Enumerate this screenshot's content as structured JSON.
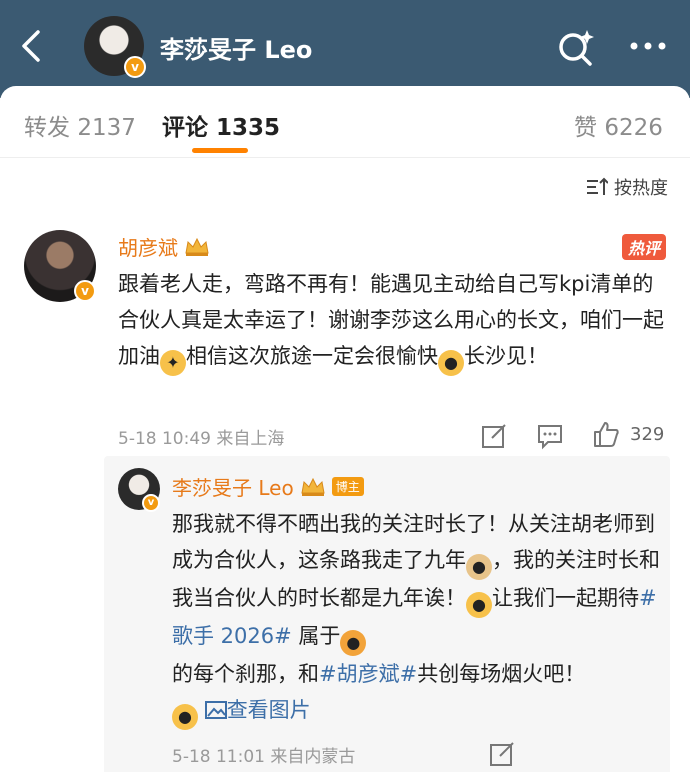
{
  "header": {
    "title": "李莎旻子 Leo",
    "verified_badge": "v",
    "back_icon": "chevron-left-icon",
    "search_icon": "search-sparkle-icon",
    "more_icon": "more-dots-icon"
  },
  "tabs": [
    {
      "label": "转发",
      "count": "2137"
    },
    {
      "label": "评论",
      "count": "1335"
    },
    {
      "label": "赞",
      "count": "6226"
    }
  ],
  "sort_label": "按热度",
  "comment": {
    "author": "胡彦斌",
    "hot_label": "热评",
    "text_parts": [
      "跟着老人走，弯路不再有！能遇见主动给自己写kpi清单的合伙人真是太幸运了！谢谢李莎这么用心的长文，咱们一起加油",
      "相信这次旅途一定会很愉快",
      "长沙见！"
    ],
    "time": "5-18 10:49",
    "location": "来自上海",
    "likes": "329"
  },
  "reply": {
    "author": "李莎旻子 Leo",
    "owner_badge": "博主",
    "text_parts": [
      "那我就不得不晒出我的关注时长了！从关注胡老师到成为合伙人，这条路我走了九年",
      "，我的关注时长和我当合伙人的时长都是九年诶！",
      "让我们一起期待",
      "#歌手 2026#",
      " 属于",
      "的每个刹那，和",
      "#胡彦斌#",
      "共创每场烟火吧！"
    ],
    "view_image_label": "查看图片",
    "time": "5-18 11:01",
    "location": "来自内蒙古"
  },
  "colors": {
    "accent": "#ff8200",
    "name": "#e77a1a",
    "link": "#3d6fa8",
    "topbar": "#3b5a72"
  }
}
